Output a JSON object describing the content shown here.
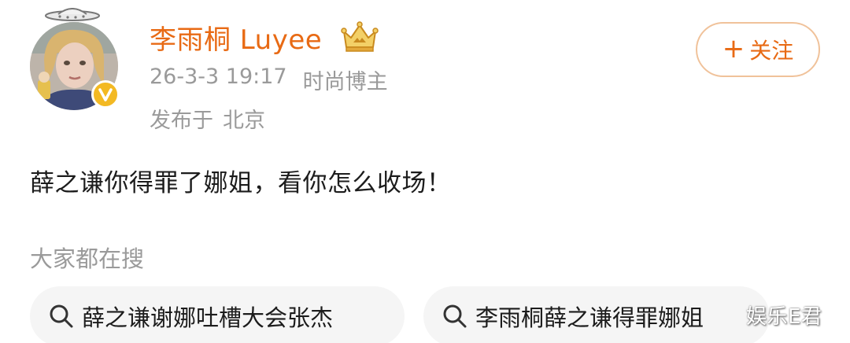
{
  "user": {
    "name": "李雨桐 Luyee",
    "avatar_icon": "avatar-photo",
    "verified_icon": "verified-badge-icon",
    "badge_icon": "crown-icon"
  },
  "post": {
    "time": "26-3-3 19:17",
    "category": "时尚博主",
    "location_prefix": "发布于",
    "location": "北京",
    "text": "薛之谦你得罪了娜姐，看你怎么收场！"
  },
  "follow_button": {
    "plus": "+",
    "label": "关注"
  },
  "search_section": {
    "title": "大家都在搜",
    "chips": [
      {
        "label": "薛之谦谢娜吐槽大会张杰"
      },
      {
        "label": "李雨桐薛之谦得罪娜姐"
      }
    ]
  },
  "watermark": "娱乐E君",
  "colors": {
    "accent": "#e86a14",
    "muted_text": "#9a9a9a",
    "chip_bg": "#f5f5f5",
    "verified": "#f3b923"
  }
}
